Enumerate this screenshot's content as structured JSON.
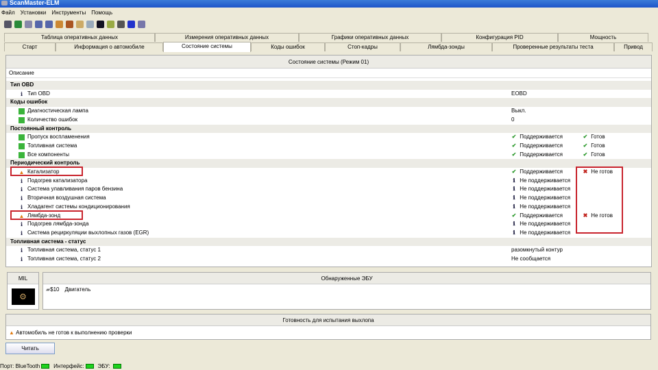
{
  "window": {
    "title": "ScanMaster-ELM"
  },
  "menu": [
    "Файл",
    "Установки",
    "Инструменты",
    "Помощь"
  ],
  "toolbar_icons": [
    "wrench-icon",
    "globe-icon",
    "document-icon",
    "table-icon",
    "chart-icon",
    "color-chart-icon",
    "person-icon",
    "clipboard-icon",
    "chat-icon",
    "terminal-icon",
    "battery-icon",
    "gauge-icon",
    "info-icon",
    "exit-icon"
  ],
  "tabs_row1": [
    "Таблица оперативных данных",
    "Измерения оперативных данных",
    "Графики оперативных данных",
    "Конфигурация PID",
    "Мощность"
  ],
  "tabs_row2": [
    "Старт",
    "Информация о автомобиле",
    "Состояние системы",
    "Коды ошибок",
    "Стоп-кадры",
    "Лямбда-зонды",
    "Проверенные результаты теста",
    "Привод"
  ],
  "panel": {
    "title": "Состояние системы (Режим 01)",
    "col_description": "Описание",
    "rows": [
      {
        "type": "group",
        "label": "Тип OBD"
      },
      {
        "type": "item",
        "icon": "info",
        "label": "Тип OBD",
        "value": "EOBD"
      },
      {
        "type": "group",
        "label": "Коды ошибок"
      },
      {
        "type": "item",
        "icon": "green",
        "label": "Диагностическая лампа",
        "value": "Выкл."
      },
      {
        "type": "item",
        "icon": "green",
        "label": "Количество ошибок",
        "value": "0"
      },
      {
        "type": "group",
        "label": "Постоянный контроль"
      },
      {
        "type": "item",
        "icon": "green",
        "label": "Пропуск воспламенения",
        "support_icon": "ok",
        "value": "Поддерживается",
        "status_icon": "ok",
        "status": "Готов"
      },
      {
        "type": "item",
        "icon": "green",
        "label": "Топливная система",
        "support_icon": "ok",
        "value": "Поддерживается",
        "status_icon": "ok",
        "status": "Готов"
      },
      {
        "type": "item",
        "icon": "green",
        "label": "Все компоненты",
        "support_icon": "ok",
        "value": "Поддерживается",
        "status_icon": "ok",
        "status": "Готов"
      },
      {
        "type": "group",
        "label": "Периодический контроль"
      },
      {
        "type": "item",
        "icon": "warn",
        "label": "Катализатор",
        "support_icon": "ok",
        "value": "Поддерживается",
        "status_icon": "bad",
        "status": "Не готов",
        "highlight": true
      },
      {
        "type": "item",
        "icon": "info",
        "label": "Подогрев катализатора",
        "support_icon": "info",
        "value": "Не поддерживается"
      },
      {
        "type": "item",
        "icon": "info",
        "label": "Система улавливания паров бензина",
        "support_icon": "info",
        "value": "Не поддерживается"
      },
      {
        "type": "item",
        "icon": "info",
        "label": "Вторичная воздушная система",
        "support_icon": "info",
        "value": "Не поддерживается"
      },
      {
        "type": "item",
        "icon": "info",
        "label": "Хладагент системы кондиционирования",
        "support_icon": "info",
        "value": "Не поддерживается"
      },
      {
        "type": "item",
        "icon": "warn",
        "label": "Лямбда-зонд",
        "support_icon": "ok",
        "value": "Поддерживается",
        "status_icon": "bad",
        "status": "Не готов",
        "highlight": true
      },
      {
        "type": "item",
        "icon": "info",
        "label": "Подогрев лямбда-зонда",
        "support_icon": "info",
        "value": "Не поддерживается"
      },
      {
        "type": "item",
        "icon": "info",
        "label": "Система рециркуляции выхлопных газов (EGR)",
        "support_icon": "info",
        "value": "Не поддерживается"
      },
      {
        "type": "group",
        "label": "Топливная система - статус"
      },
      {
        "type": "item",
        "icon": "info",
        "label": "Топливная система, статус 1",
        "value": "разомкнутый контур"
      },
      {
        "type": "item",
        "icon": "info",
        "label": "Топливная система, статус 2",
        "value": "Не сообщается"
      }
    ]
  },
  "mil": {
    "title": "MIL"
  },
  "ecu": {
    "title": "Обнаруженные ЭБУ",
    "id": "$10",
    "name": "Двигатель"
  },
  "readiness": {
    "title": "Готовность для испытания выхлопа",
    "message": "Автомобиль не готов к выполнению проверки"
  },
  "read_button": "Читать",
  "statusbar": {
    "port": "Порт: BlueTooth",
    "interface": "Интерфейс:",
    "ecu": "ЭБУ:"
  },
  "colors": {
    "ok": "#2d9a2d",
    "bad": "#c0201a",
    "highlight": "#c8232c",
    "led": "#1ed21e"
  }
}
